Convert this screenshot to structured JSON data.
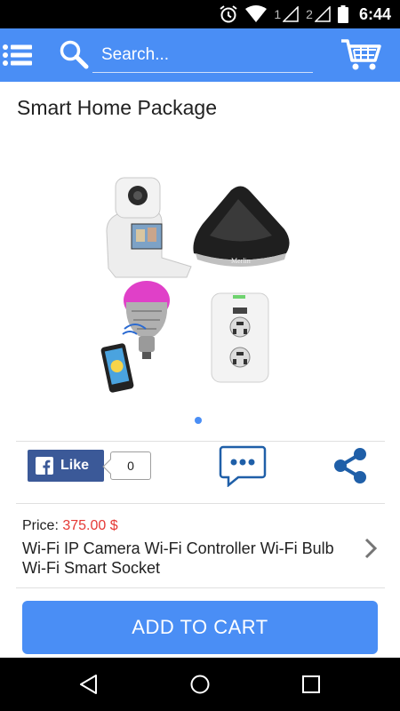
{
  "status_bar": {
    "time": "6:44",
    "sim1": "1",
    "sim2": "2"
  },
  "app_bar": {
    "search_placeholder": "Search...",
    "icons": [
      "menu-icon",
      "search-icon",
      "cart-icon"
    ],
    "color": "#4a8ef5"
  },
  "product": {
    "title": "Smart Home Package",
    "image": "product-image",
    "image_pages": 1,
    "price_label": "Price:",
    "price_value": "375.00 $",
    "description": "Wi-Fi IP Camera Wi-Fi Controller Wi-Fi Bulb Wi-Fi Smart Socket"
  },
  "social": {
    "like_label": "Like",
    "like_count": "0",
    "icons": [
      "facebook-icon",
      "comment-icon",
      "share-icon"
    ]
  },
  "actions": {
    "add_to_cart": "ADD TO CART"
  },
  "nav_bar": {
    "icons": [
      "back-icon",
      "home-icon",
      "recents-icon"
    ]
  },
  "colors": {
    "primary": "#4a8ef5",
    "price": "#e53935",
    "facebook": "#3b5998"
  }
}
